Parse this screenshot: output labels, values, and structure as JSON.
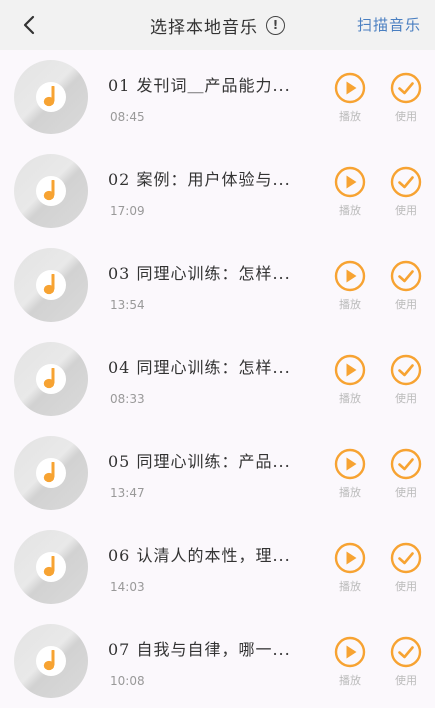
{
  "header": {
    "back_icon": "chevron-left-icon",
    "title": "选择本地音乐",
    "info_symbol": "!",
    "scan_label": "扫描音乐"
  },
  "colors": {
    "accent": "#f7a332",
    "link": "#4a7fc1"
  },
  "actions": {
    "play_label": "播放",
    "use_label": "使用"
  },
  "tracks": [
    {
      "name": "01 发刊词＿产品能力...",
      "duration": "08:45"
    },
    {
      "name": "02 案例：用户体验与...",
      "duration": "17:09"
    },
    {
      "name": "03 同理心训练：怎样...",
      "duration": "13:54"
    },
    {
      "name": "04 同理心训练：怎样...",
      "duration": "08:33"
    },
    {
      "name": "05 同理心训练：产品...",
      "duration": "13:47"
    },
    {
      "name": "06 认清人的本性，理...",
      "duration": "14:03"
    },
    {
      "name": "07 自我与自律，哪一...",
      "duration": "10:08"
    }
  ]
}
